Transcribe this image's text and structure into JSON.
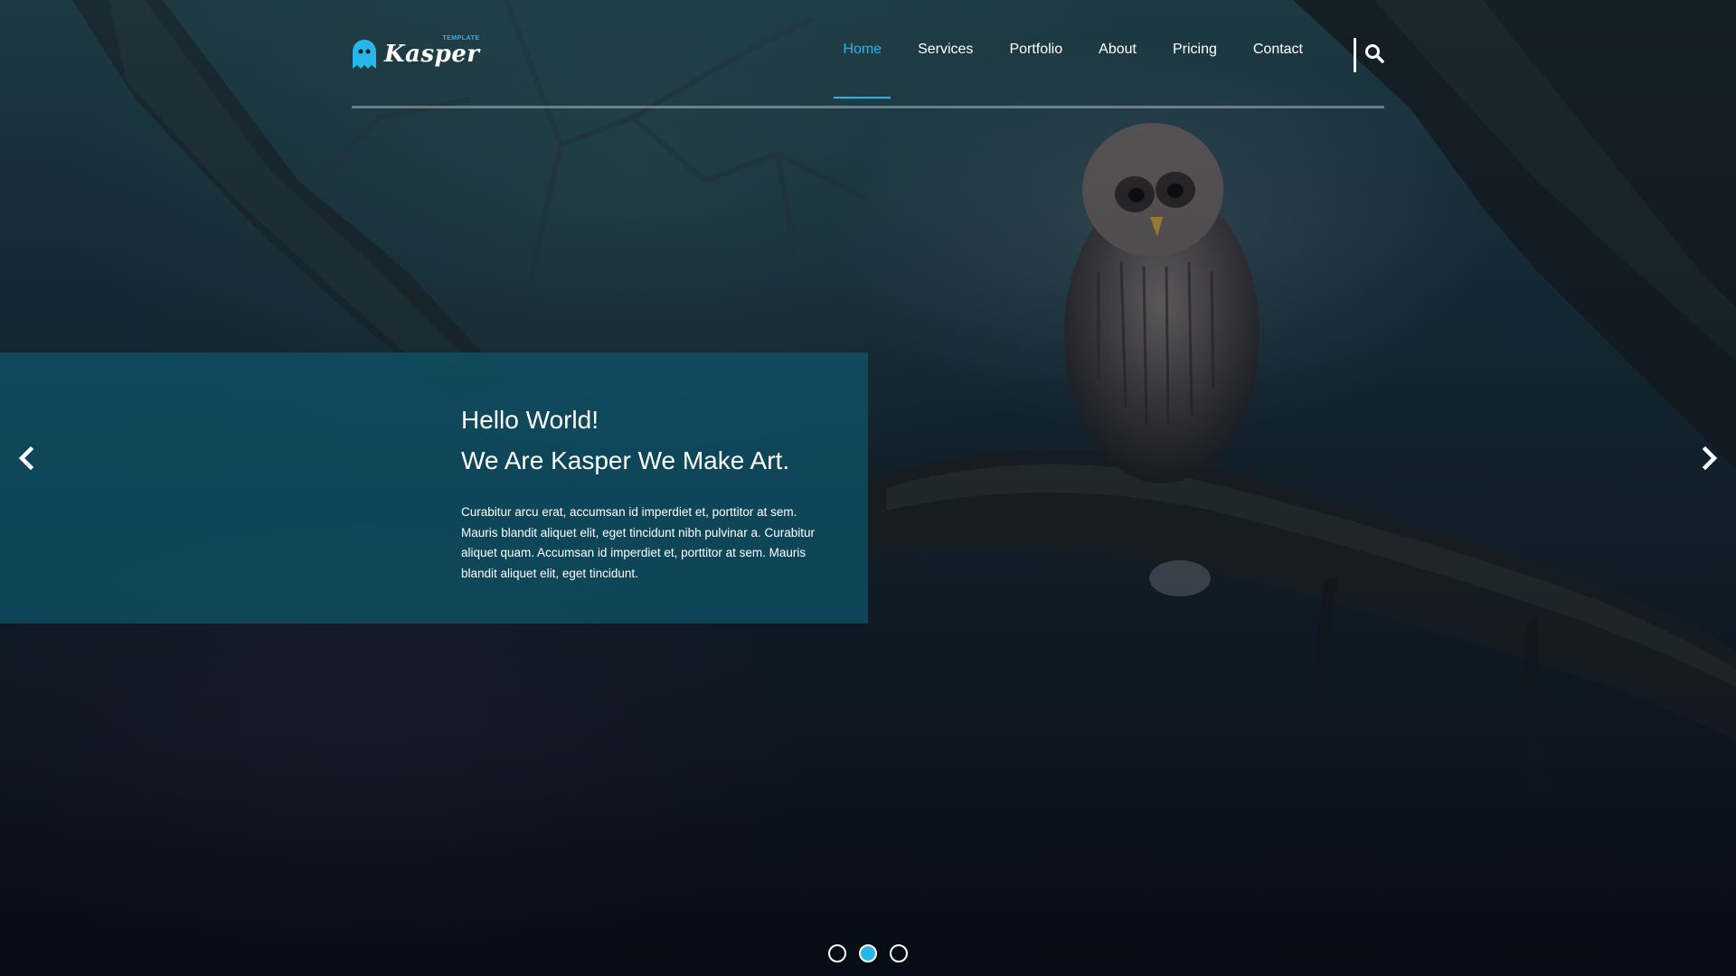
{
  "brand": {
    "name": "Kasper",
    "sub": "TEMPLATE",
    "accent": "#27b6e8"
  },
  "nav": {
    "items": [
      {
        "label": "Home",
        "active": true
      },
      {
        "label": "Services",
        "active": false
      },
      {
        "label": "Portfolio",
        "active": false
      },
      {
        "label": "About",
        "active": false
      },
      {
        "label": "Pricing",
        "active": false
      },
      {
        "label": "Contact",
        "active": false
      }
    ],
    "search_icon": "search-icon"
  },
  "slider": {
    "title_line1": "Hello World!",
    "title_line2": "We Are Kasper We Make Art.",
    "text": "Curabitur arcu erat, accumsan id imperdiet et, porttitor at sem. Mauris blandit aliquet elit, eget tincidunt nibh pulvinar a. Curabitur aliquet quam. Accumsan id imperdiet et, porttitor at sem. Mauris blandit aliquet elit, eget tincidunt.",
    "prev_icon": "chevron-left-icon",
    "next_icon": "chevron-right-icon",
    "bullets": [
      {
        "active": false
      },
      {
        "active": true
      },
      {
        "active": false
      }
    ]
  }
}
